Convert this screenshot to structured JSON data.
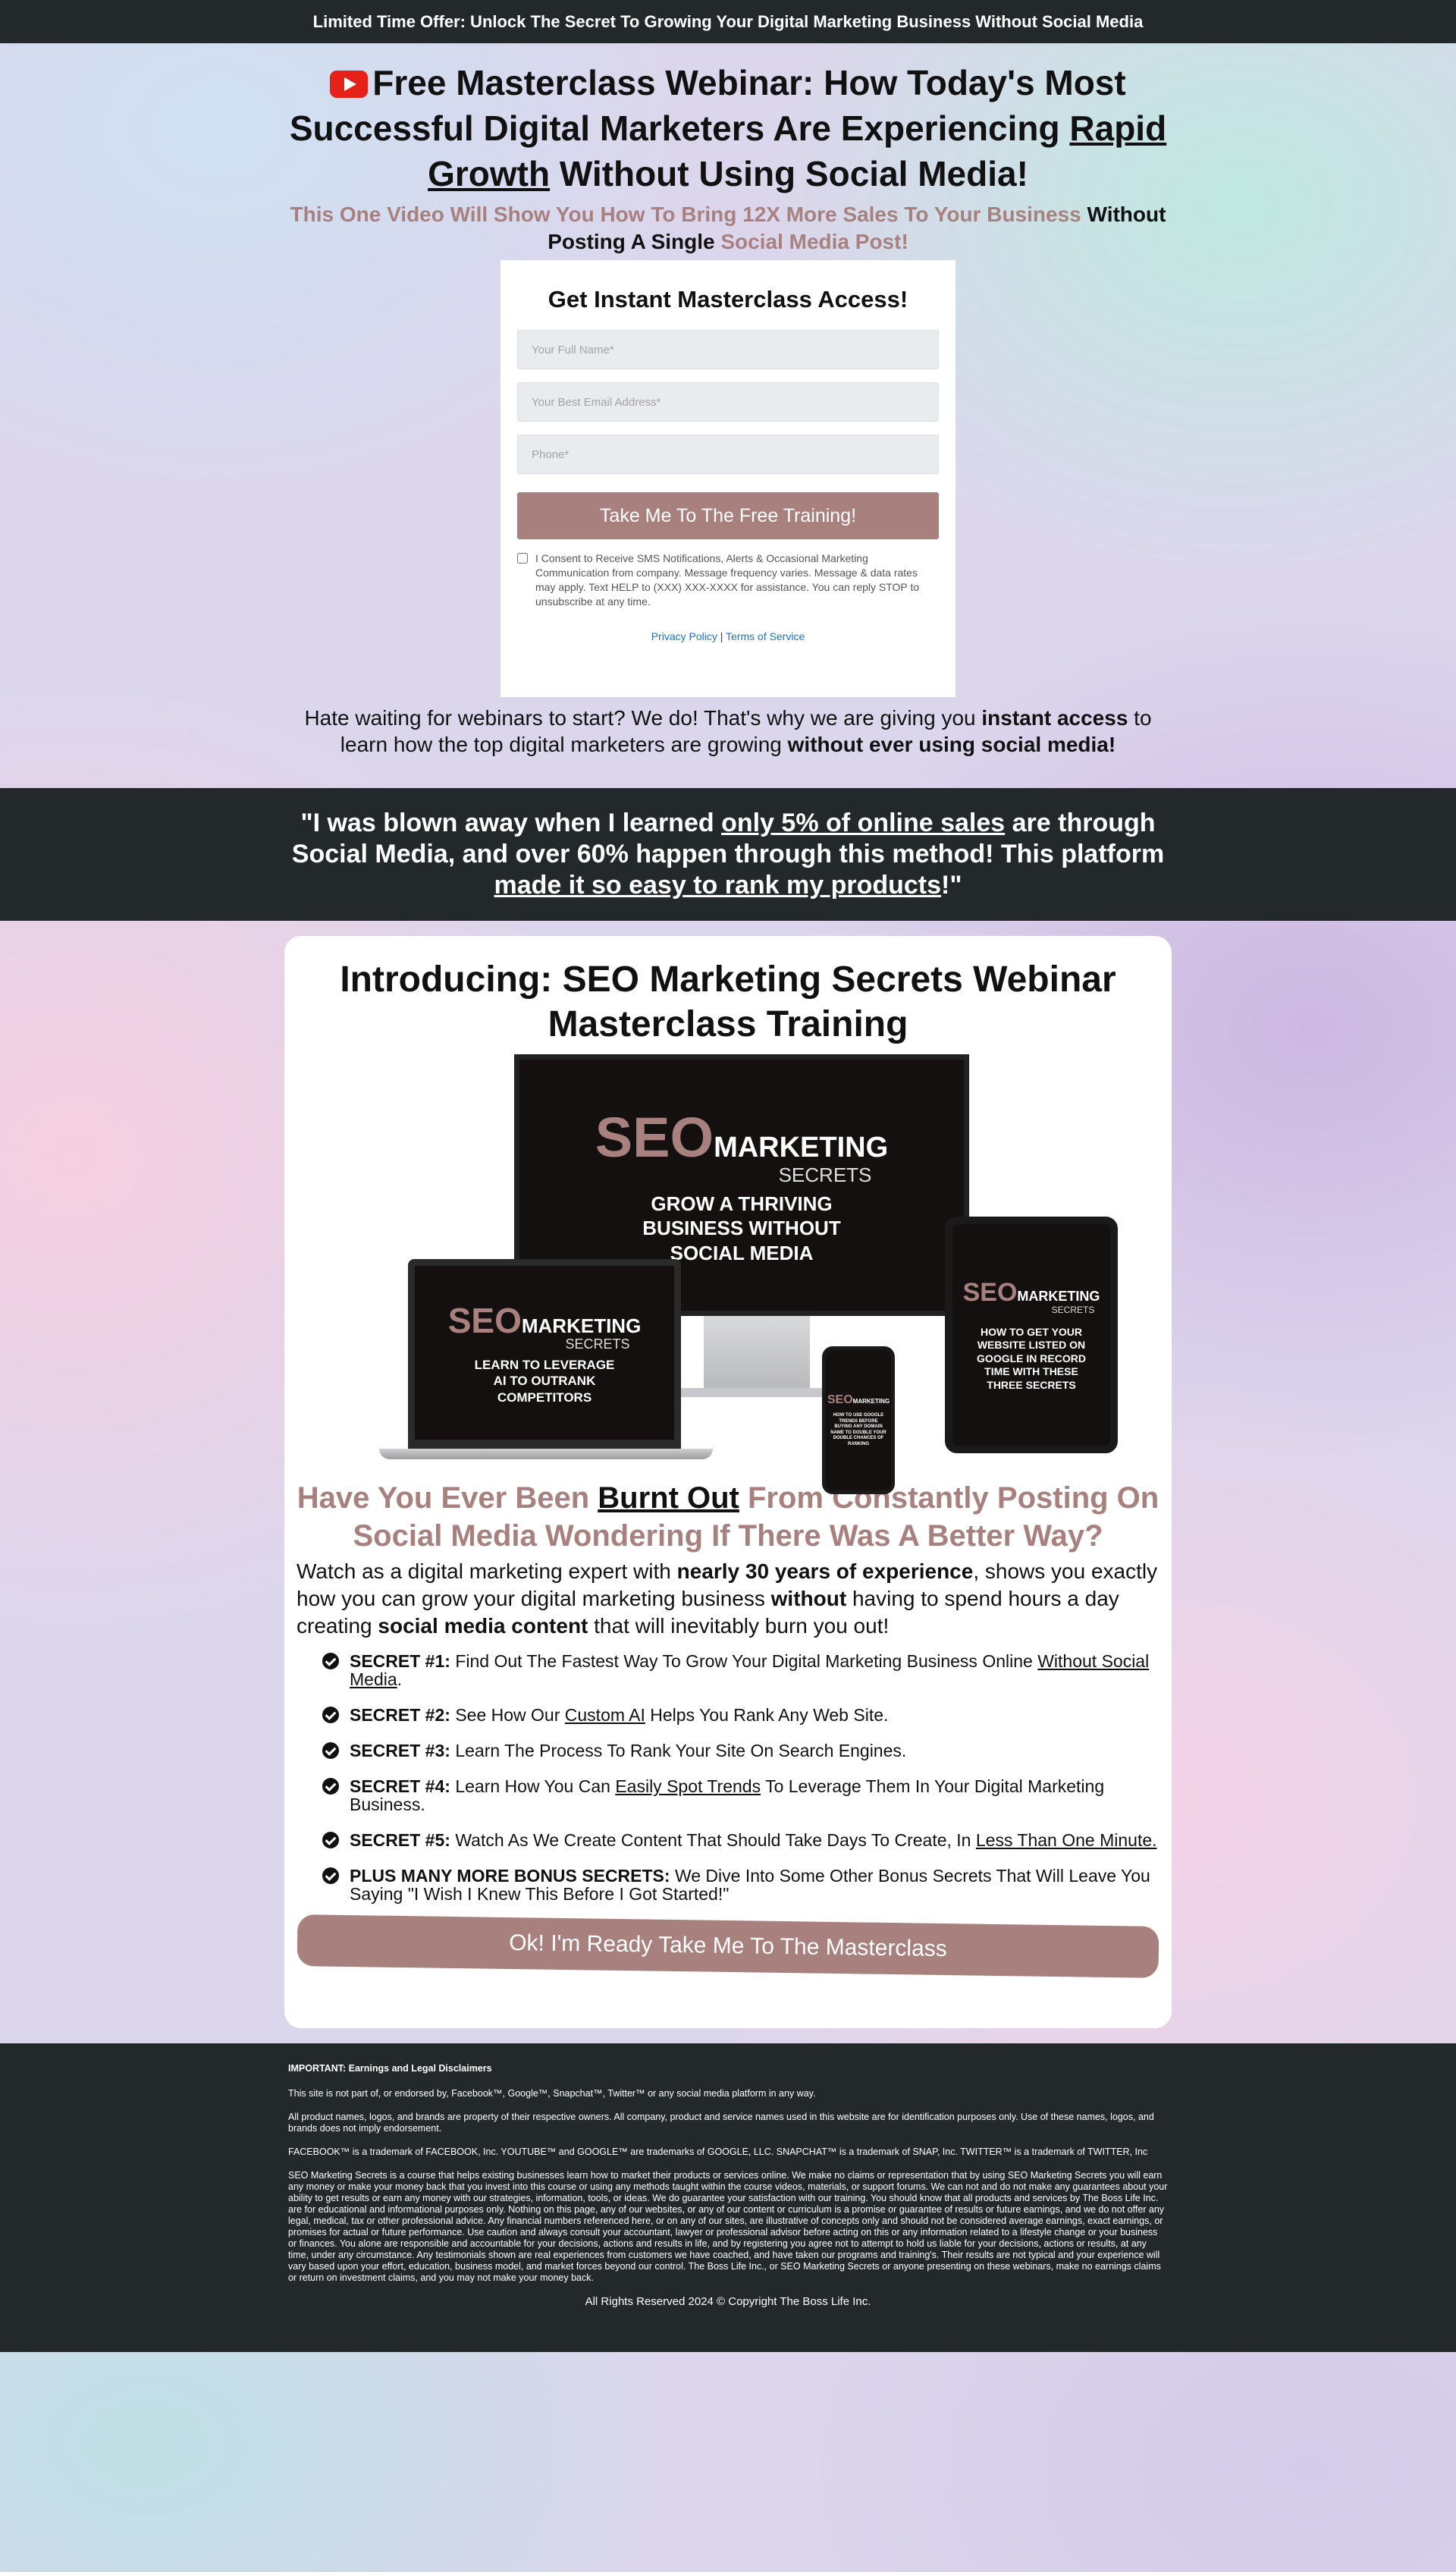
{
  "topbar": {
    "text": "Limited Time Offer: Unlock The Secret To Growing Your Digital Marketing Business Without Social Media"
  },
  "hero": {
    "title_a": "Free Masterclass Webinar: How Today's Most Successful Digital Marketers Are Experiencing ",
    "title_b": "Rapid Growth",
    "title_c": " Without Using Social Media!",
    "sub_a": "This One Video Will Show You How To Bring 12X More Sales To Your Business",
    "sub_b": " Without Posting A Single ",
    "sub_c": "Social Media Post!",
    "wait_a": "Hate waiting for webinars to start? We do! That's why we are giving you ",
    "wait_b": "instant access",
    "wait_c": " to learn how the top digital marketers are growing ",
    "wait_d": "without ever using social media!"
  },
  "optin": {
    "heading": "Get Instant Masterclass Access!",
    "name_placeholder": "Your Full Name*",
    "email_placeholder": "Your Best Email Address*",
    "phone_placeholder": "Phone*",
    "submit_label": "Take Me To The Free Training!",
    "consent_text": "I Consent to Receive SMS Notifications, Alerts & Occasional Marketing Communication from company. Message frequency varies. Message & data rates may apply. Text HELP to (XXX) XXX-XXXX for assistance. You can reply STOP to unsubscribe at any time.",
    "privacy_label": "Privacy Policy",
    "sep": " | ",
    "terms_label": "Terms of Service"
  },
  "quote": {
    "a": "\"I was blown away when I learned ",
    "b": "only 5% of online sales",
    "c": " are through Social Media, and over 60% happen through this method! This platform ",
    "d": "made it so easy to rank my products",
    "e": "!\""
  },
  "card": {
    "heading": "Introducing: SEO Marketing Secrets Webinar Masterclass Training",
    "mockup": {
      "seo": "SEO",
      "marketing": "MARKETING",
      "secrets": "SECRETS",
      "monitor_tag": "GROW A THRIVING BUSINESS WITHOUT SOCIAL MEDIA",
      "laptop_tag": "LEARN TO LEVERAGE AI TO OUTRANK COMPETITORS",
      "tablet_tag": "HOW TO GET YOUR WEBSITE LISTED ON GOOGLE IN RECORD TIME WITH THESE THREE SECRETS",
      "phone_tag": "HOW TO USE GOOGLE TRENDS BEFORE BUYING ANY DOMAIN NAME TO DOUBLE YOUR DOUBLE CHANCES OF RANKING"
    },
    "burnt_a": "Have You Ever Been ",
    "burnt_b": "Burnt Out",
    "burnt_c": " From Constantly Posting On Social Media Wondering If There Was A Better Way?",
    "watch_a": "Watch as a digital marketing expert with ",
    "watch_b": "nearly 30 years of experience",
    "watch_c": ", shows you exactly how you can grow your digital marketing business ",
    "watch_d": "without",
    "watch_e": " having to spend hours a day creating ",
    "watch_f": "social media content",
    "watch_g": " that will inevitably burn you out!",
    "secrets": [
      {
        "label": "SECRET #1:",
        "pre": " Find Out The Fastest Way To Grow Your Digital Marketing Business Online ",
        "u": "Without Social Media",
        "post": "."
      },
      {
        "label": "SECRET #2:",
        "pre": " See How Our ",
        "u": "Custom AI",
        "post": " Helps You Rank Any Web Site."
      },
      {
        "label": "SECRET #3:",
        "pre": " Learn The Process To Rank Your Site On Search Engines.",
        "u": "",
        "post": ""
      },
      {
        "label": "SECRET #4:",
        "pre": " Learn How You Can ",
        "u": "Easily Spot Trends",
        "post": " To Leverage Them In Your Digital Marketing Business."
      },
      {
        "label": "SECRET #5:",
        "pre": " Watch As We Create Content That Should Take Days To Create, In ",
        "u": "Less Than One Minute.",
        "post": ""
      },
      {
        "label": "PLUS MANY MORE BONUS SECRETS:",
        "pre": " We Dive Into Some Other Bonus Secrets That Will Leave You Saying \"I Wish I Knew This Before I Got Started!\"",
        "u": "",
        "post": ""
      }
    ],
    "final_cta": "Ok! I'm Ready Take Me To The Masterclass"
  },
  "footer": {
    "important": "IMPORTANT: Earnings and Legal Disclaimers",
    "p1": "This site is not part of, or endorsed by, Facebook™, Google™, Snapchat™, Twitter™ or any social media platform in any way.",
    "p2": "All product names, logos, and brands are property of their respective owners. All company, product and service names used in this website are for identification purposes only. Use of these names, logos, and brands does not imply endorsement.",
    "p3": "FACEBOOK™ is a trademark of FACEBOOK, Inc. YOUTUBE™ and GOOGLE™ are trademarks of GOOGLE, LLC. SNAPCHAT™ is a trademark of SNAP, Inc. TWITTER™ is a trademark of TWITTER, Inc",
    "p4": "SEO Marketing Secrets is a course that helps existing businesses learn how to market their products or services online. We make no claims or representation that by using SEO Marketing Secrets you will earn any money or make your money back that you invest into this course or using any methods taught within the course videos, materials, or support forums. We can not and do not make any guarantees about your ability to get results or earn any money with our strategies, information, tools, or ideas. We do guarantee your satisfaction with our training. You should know that all products and services by The Boss Life Inc. are for educational and informational purposes only. Nothing on this page, any of our websites, or any of our content or curriculum is a promise or guarantee of results or future earnings, and we do not offer any legal, medical, tax or other professional advice. Any financial numbers referenced here, or on any of our sites, are illustrative of concepts only and should not be considered average earnings, exact earnings, or promises for actual or future performance. Use caution and always consult your accountant, lawyer or professional advisor before acting on this or any information related to a lifestyle change or your business or finances. You alone are responsible and accountable for your decisions, actions and results in life, and by registering you agree not to attempt to hold us liable for your decisions, actions or results, at any time, under any circumstance. Any testimonials shown are real experiences from customers we have coached, and have taken our programs and training's. Their results are not typical and your experience will vary based upon your effort, education, business model, and market forces beyond our control. The Boss Life Inc., or SEO Marketing Secrets or anyone presenting on these webinars, make no earnings claims or return on investment claims, and you may not make your money back.",
    "copyright": "All Rights Reserved 2024 © Copyright The Boss Life Inc."
  },
  "colors": {
    "accent": "#a8817f",
    "dark": "#23282b",
    "link": "#1a73c9"
  }
}
